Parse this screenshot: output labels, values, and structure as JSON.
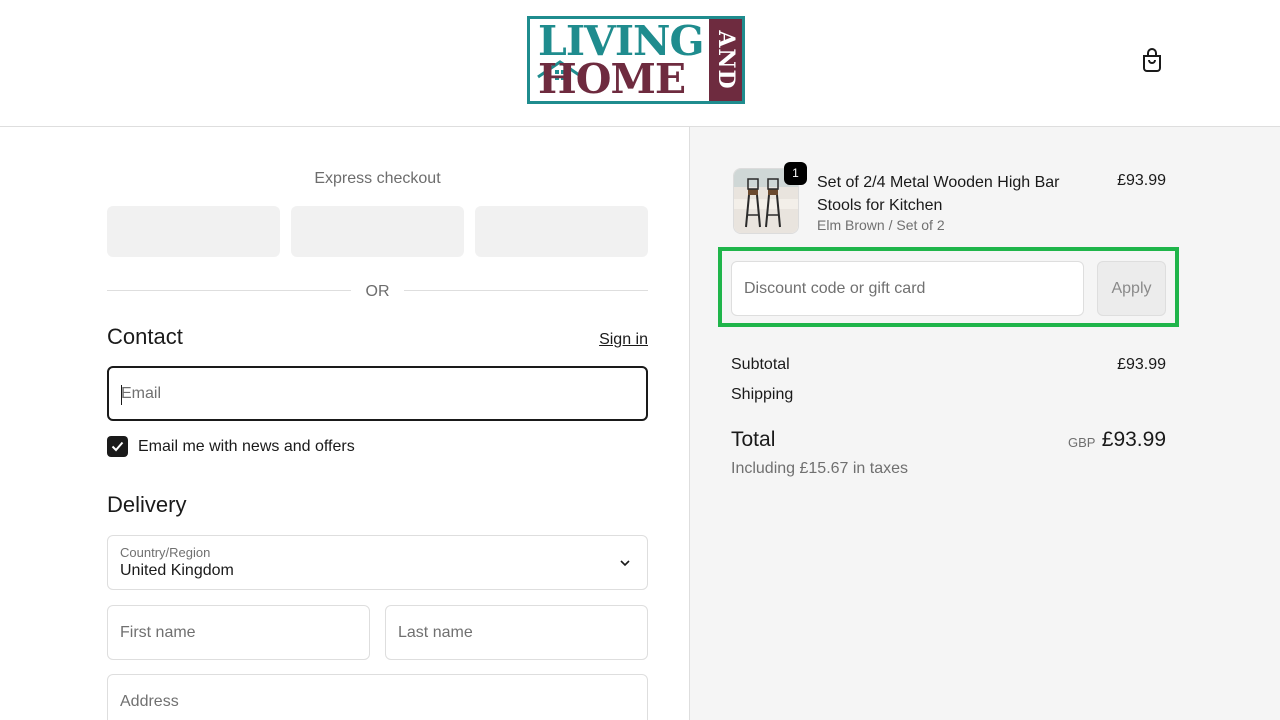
{
  "header": {
    "logo": {
      "line1": "LIVING",
      "line2": "HOME",
      "and": "AND"
    },
    "colors": {
      "teal": "#1f8c8e",
      "maroon": "#6e2b3f"
    },
    "cart_icon": "shopping-bag-icon"
  },
  "checkout": {
    "express_title": "Express checkout",
    "or_label": "OR",
    "contact": {
      "title": "Contact",
      "sign_in": "Sign in",
      "email_placeholder": "Email",
      "newsletter_label": "Email me with news and offers",
      "newsletter_checked": true
    },
    "delivery": {
      "title": "Delivery",
      "country_label": "Country/Region",
      "country_value": "United Kingdom",
      "first_name_placeholder": "First name",
      "last_name_placeholder": "Last name",
      "address_placeholder": "Address"
    }
  },
  "summary": {
    "product": {
      "quantity": "1",
      "name": "Set of 2/4 Metal Wooden High Bar Stools for Kitchen",
      "variant": "Elm Brown / Set of 2",
      "price": "£93.99"
    },
    "discount_placeholder": "Discount code or gift card",
    "apply_label": "Apply",
    "subtotal_label": "Subtotal",
    "subtotal_value": "£93.99",
    "shipping_label": "Shipping",
    "total_label": "Total",
    "total_currency": "GBP",
    "total_value": "£93.99",
    "tax_note": "Including £15.67 in taxes",
    "highlight_color": "#1fb54a"
  }
}
